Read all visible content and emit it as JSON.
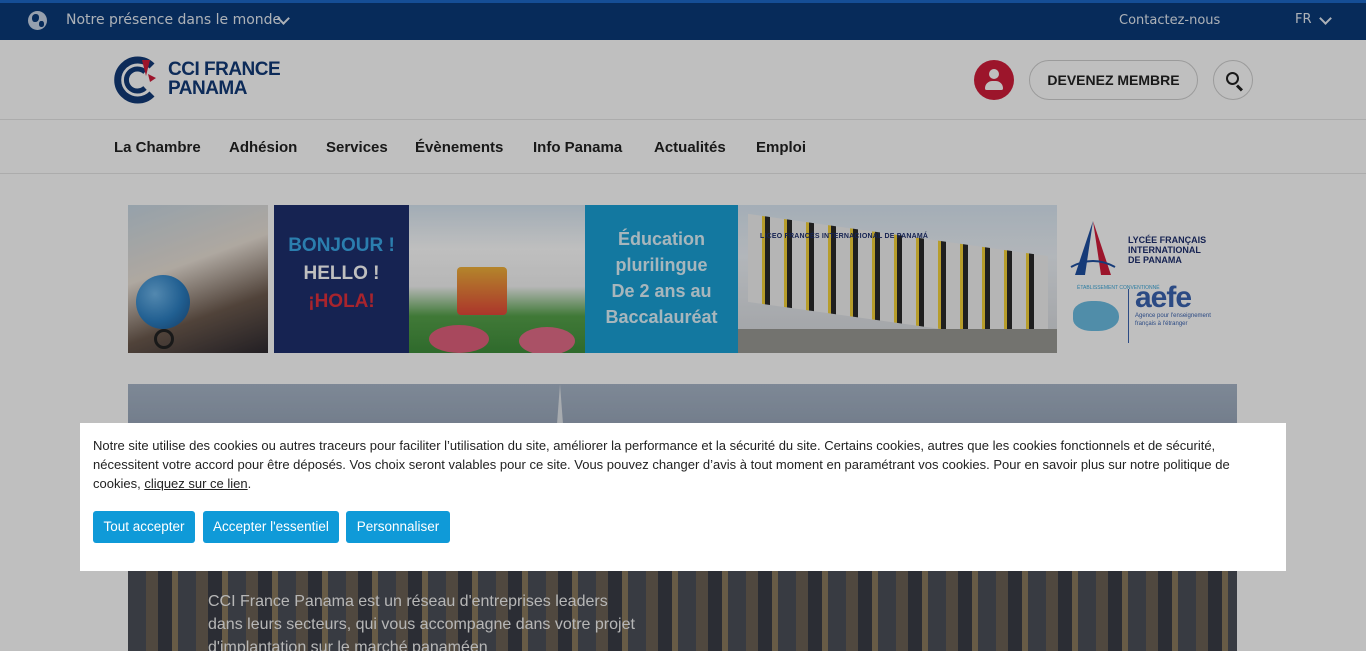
{
  "topbar": {
    "presence_label": "Notre présence dans le monde",
    "contact_label": "Contactez-nous",
    "language": "FR",
    "icons": {
      "world": "globe-icon",
      "dropdown": "chevron-down-icon"
    }
  },
  "header": {
    "logo_line1": "CCI FRANCE",
    "logo_line2": "PANAMA",
    "member_button": "DEVENEZ MEMBRE",
    "icons": {
      "user": "user-icon",
      "search": "search-icon"
    },
    "colors": {
      "brand_blue": "#123a77",
      "user_red": "#d01c3a"
    }
  },
  "nav": {
    "items": [
      {
        "label": "La Chambre"
      },
      {
        "label": "Adhésion"
      },
      {
        "label": "Services"
      },
      {
        "label": "Évènements"
      },
      {
        "label": "Info Panama"
      },
      {
        "label": "Actualités"
      },
      {
        "label": "Emploi"
      }
    ]
  },
  "banner": {
    "hello": [
      "BONJOUR !",
      "HELLO !",
      "¡HOLA!"
    ],
    "education": [
      "Éducation",
      "plurilingue",
      "De 2 ans au",
      "Baccalauréat"
    ],
    "school_sign": "LICEO FRANCÉS INTERNACIONAL DE PANAMÁ",
    "lycee_name": [
      "LYCÉE FRANÇAIS",
      "INTERNATIONAL",
      "DE PANAMA"
    ],
    "aefe": "aefe",
    "aefe_sub": "Agence pour l'enseignement français à l'étranger",
    "etablissement": "ÉTABLISSEMENT CONVENTIONNÉ"
  },
  "hero": {
    "text": "CCI France Panama est un réseau d'entreprises leaders dans leurs secteurs, qui vous accompagne dans votre projet d'implantation sur le marché panaméen"
  },
  "cookie": {
    "message": "Notre site utilise des cookies ou autres traceurs pour faciliter l’utilisation du site, améliorer la performance et la sécurité du site. Certains cookies, autres que les cookies fonctionnels et de sécurité, nécessitent votre accord pour être déposés. Vos choix seront valables pour ce site. Vous pouvez changer d’avis à tout moment en paramétrant vos cookies. Pour en savoir plus sur notre politique de cookies, ",
    "link_label": "cliquez sur ce lien",
    "message_end": ".",
    "buttons": {
      "accept_all": "Tout accepter",
      "accept_essential": "Accepter l'essentiel",
      "customize": "Personnaliser"
    },
    "button_color": "#0f9ad8"
  }
}
